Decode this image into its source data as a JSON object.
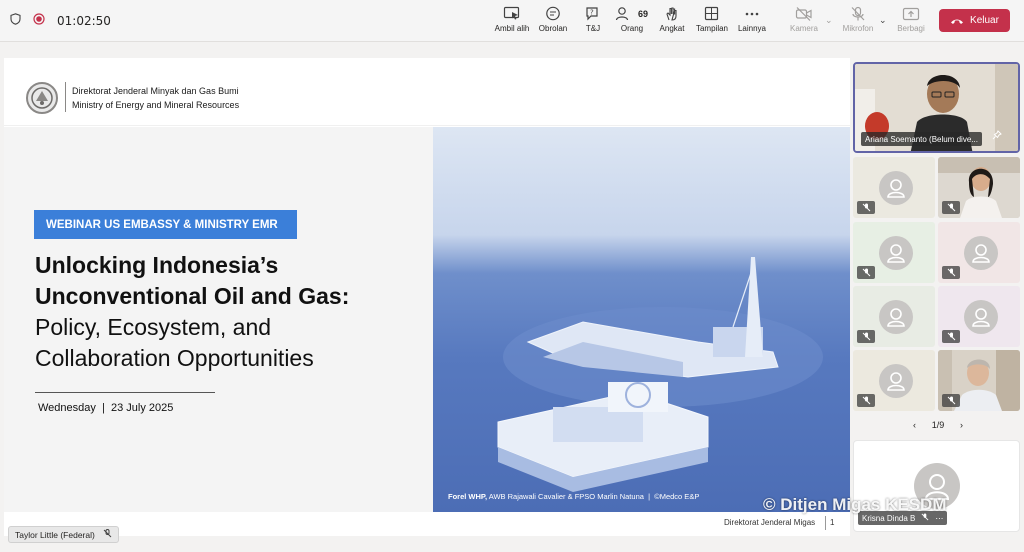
{
  "meeting": {
    "timer": "01:02:50",
    "leave_label": "Keluar"
  },
  "toolbar": {
    "ambil_alih": "Ambil alih",
    "obrolan": "Obrolan",
    "tj": "T&J",
    "orang": "Orang",
    "orang_count": "69",
    "angkat": "Angkat",
    "tampilan": "Tampilan",
    "lainnya": "Lainnya",
    "kamera": "Kamera",
    "mikrofon": "Mikrofon",
    "berbagi": "Berbagi"
  },
  "slide": {
    "org_line1": "Direktorat Jenderal Minyak dan Gas Bumi",
    "org_line2": "Ministry of Energy and Mineral Resources",
    "banner": "WEBINAR US EMBASSY & MINISTRY EMR",
    "title_line1": "Unlocking Indonesia’s",
    "title_line2": "Unconventional Oil and Gas:",
    "title_line3": "Policy, Ecosystem, and",
    "title_line4": "Collaboration Opportunities",
    "date": "Wednesday  |  23 July 2025",
    "caption_bold": "Forel WHP,",
    "caption_rest": " AWB Rajawali Cavalier & FPSO Marlin Natuna  |  ©Medco E&P",
    "footer_org": "Direktorat Jenderal Migas",
    "footer_page": "1"
  },
  "participants": {
    "featured_name": "Ariana Soemanto (Belum dive...",
    "bottom_name": "Krisna Dinda B",
    "pager": "1/9",
    "self_name": "Taylor Little (Federal)"
  },
  "watermark": "© Ditjen Migas KESDM",
  "colors": {
    "leave": "#c4314b",
    "banner": "#3b7fd9",
    "featured_border": "#6264a7"
  }
}
